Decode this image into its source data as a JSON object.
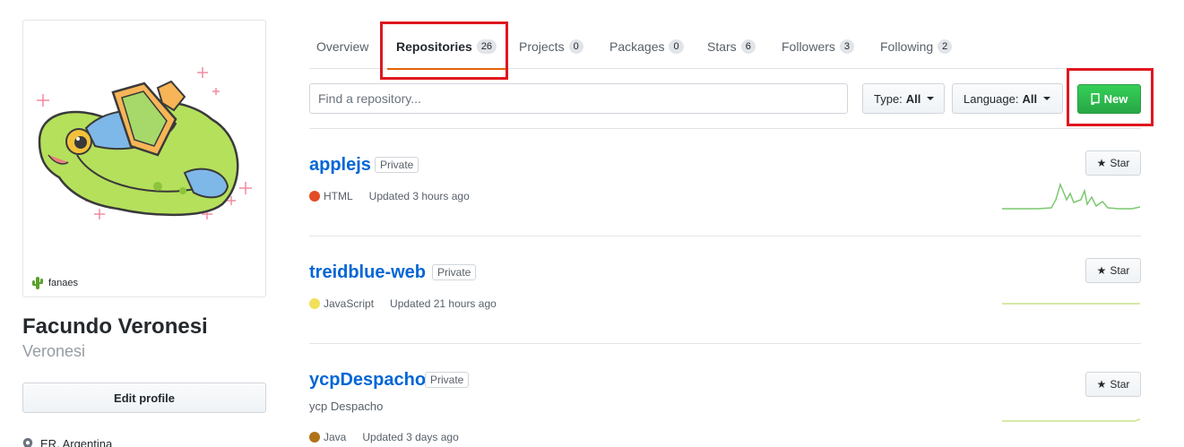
{
  "profile": {
    "status_text": "fanaes",
    "name": "Facundo Veronesi",
    "login": "Veronesi",
    "edit_label": "Edit profile",
    "location": "ER, Argentina"
  },
  "tabs": [
    {
      "label": "Overview",
      "count": ""
    },
    {
      "label": "Repositories",
      "count": "26"
    },
    {
      "label": "Projects",
      "count": "0"
    },
    {
      "label": "Packages",
      "count": "0"
    },
    {
      "label": "Stars",
      "count": "6"
    },
    {
      "label": "Followers",
      "count": "3"
    },
    {
      "label": "Following",
      "count": "2"
    }
  ],
  "filters": {
    "search_placeholder": "Find a repository...",
    "type_label": "Type:",
    "type_value": "All",
    "language_label": "Language:",
    "language_value": "All",
    "new_label": "New"
  },
  "repos": [
    {
      "name": "applejs",
      "visibility": "Private",
      "description": "",
      "language": "HTML",
      "language_color": "#e34c26",
      "updated": "Updated 3 hours ago",
      "star_label": "Star"
    },
    {
      "name": "treidblue-web",
      "visibility": "Private",
      "description": "",
      "language": "JavaScript",
      "language_color": "#f1e05a",
      "updated": "Updated 21 hours ago",
      "star_label": "Star"
    },
    {
      "name": "ycpDespacho",
      "visibility": "Private",
      "description": "ycp Despacho",
      "language": "Java",
      "language_color": "#b07219",
      "updated": "Updated 3 days ago",
      "star_label": "Star"
    }
  ],
  "colors": {
    "accent_tab": "#e36209",
    "link": "#0366d6",
    "new_button": "#28a745",
    "highlight": "#e0171f"
  }
}
